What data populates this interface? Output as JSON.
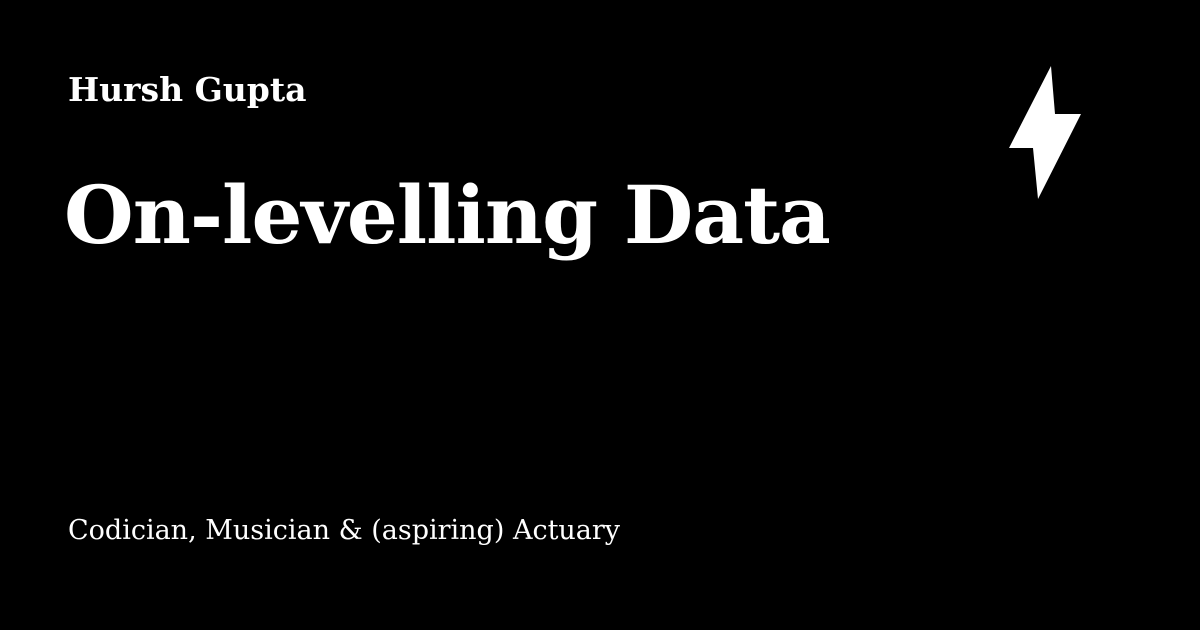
{
  "card": {
    "author": "Hursh Gupta",
    "title": "On-levelling Data",
    "tagline": "Codician, Musician & (aspiring) Actuary",
    "icon": "lightning-bolt-icon"
  },
  "colors": {
    "background": "#000000",
    "text": "#ffffff",
    "icon": "#ffffff"
  }
}
